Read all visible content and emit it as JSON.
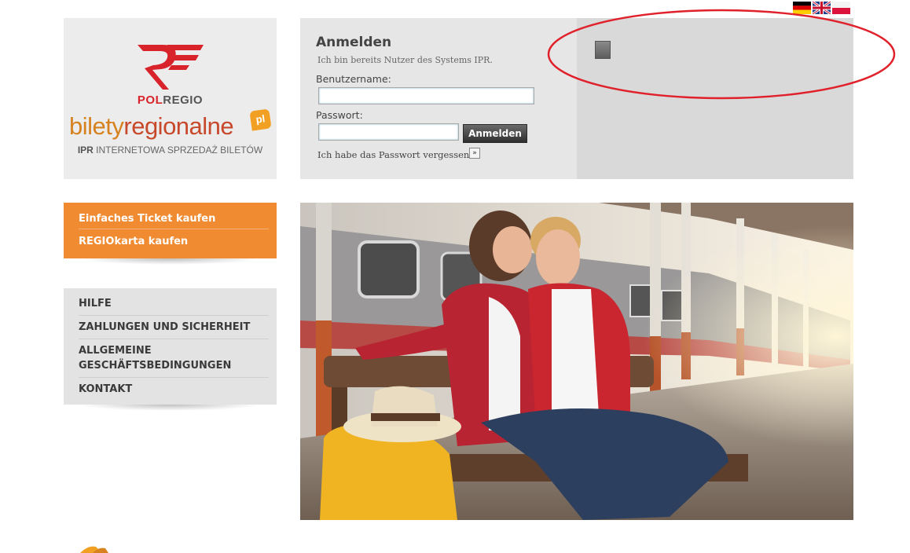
{
  "colors": {
    "accent_orange": "#f18b32",
    "panel_gray": "#e6e6e6",
    "right_panel_gray": "#d9d9d9",
    "annotation_red": "#e0212b"
  },
  "languages": [
    "de-flag-icon",
    "gb-flag-icon",
    "pl-flag-icon"
  ],
  "logo": {
    "polregio_pol": "POL",
    "polregio_regio": "REGIO",
    "bilety_a": "bilety",
    "bilety_b": "regionalne",
    "bilety_pl": "pl",
    "ipr_bold": "IPR",
    "ipr_text": " INTERNETOWA SPRZEDAŻ BILETÓW"
  },
  "login": {
    "title": "Anmelden",
    "subtitle": "Ich bin bereits Nutzer des Systems IPR.",
    "username_label": "Benutzername:",
    "username_value": "",
    "password_label": "Passwort:",
    "password_value": "",
    "submit_label": "Anmelden",
    "forgot_text": "Ich habe das Passwort vergessen.",
    "forgot_button": "»"
  },
  "menu_orange": [
    {
      "label": "Einfaches Ticket kaufen"
    },
    {
      "label": "REGIOkarta kaufen"
    }
  ],
  "menu_gray": [
    {
      "label": "HILFE"
    },
    {
      "label": "ZAHLUNGEN UND SICHERHEIT"
    },
    {
      "label": "ALLGEMEINE GESCHÄFTSBEDINGUNGEN"
    },
    {
      "label": "KONTAKT"
    }
  ]
}
